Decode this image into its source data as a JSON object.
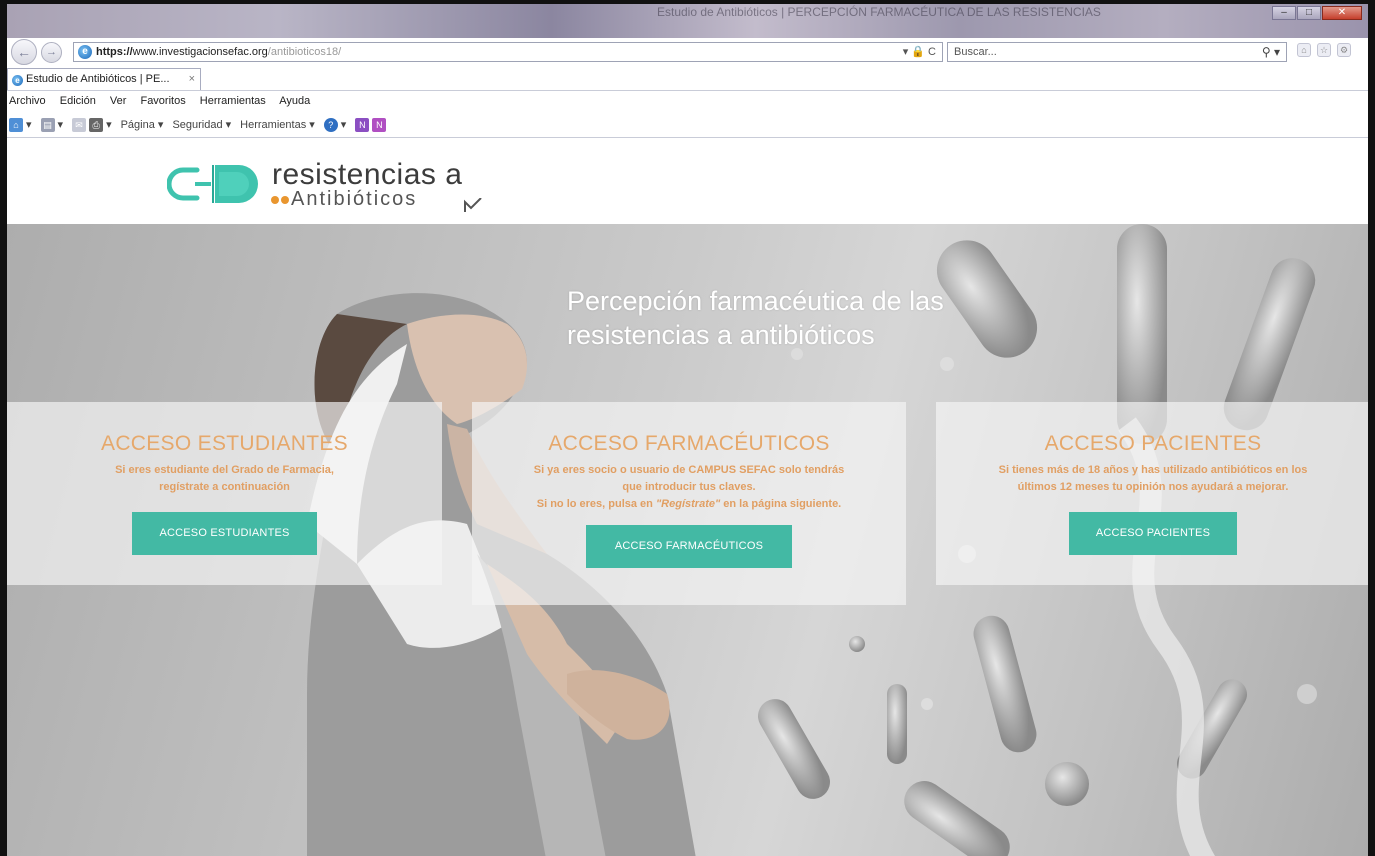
{
  "browser": {
    "window_title": "Estudio de Antibióticos | PERCEPCIÓN FARMACÉUTICA DE LAS RESISTENCIAS",
    "url_prefix": "https://",
    "url_domain": "www.investigacionsefac.org",
    "url_path": "/antibioticos18/",
    "url_controls": "▾ 🔒 C",
    "search_placeholder": "Buscar...",
    "search_icon": "⚲ ▾",
    "tab_title": "Estudio de Antibióticos | PE...",
    "tab_close": "×",
    "menu": [
      "Archivo",
      "Edición",
      "Ver",
      "Favoritos",
      "Herramientas",
      "Ayuda"
    ],
    "commands": {
      "home_arrow": "▾",
      "feeds_arrow": "▾",
      "mail_arrow": "▾",
      "print_arrow": "▾",
      "page": "Página ▾",
      "safety": "Seguridad ▾",
      "tools": "Herramientas ▾",
      "help_arrow": "▾"
    },
    "win_buttons": {
      "minimize": "–",
      "maximize": "□",
      "close": "✕"
    }
  },
  "site": {
    "logo_line1": "resistencias a",
    "logo_line2": "Antibióticos",
    "hero_title_line1": "Percepción farmacéutica de las",
    "hero_title_line2": "resistencias a antibióticos",
    "cards": [
      {
        "title": "ACCESO ESTUDIANTES",
        "desc_lines": [
          "Si eres estudiante del Grado de Farmacia,",
          "regístrate a continuación"
        ],
        "button": "ACCESO ESTUDIANTES"
      },
      {
        "title": "ACCESO FARMACÉUTICOS",
        "desc_lines": [
          "Si ya eres socio o usuario de CAMPUS SEFAC solo tendrás",
          "que introducir tus claves.",
          "Si no lo eres, pulsa en",
          "\"Regístrate\"",
          "en la página siguiente."
        ],
        "button": "ACCESO FARMACÉUTICOS"
      },
      {
        "title": "ACCESO PACIENTES",
        "desc_lines": [
          "Si tienes más de 18 años y has utilizado antibióticos en los",
          "últimos 12 meses tu opinión nos ayudará a mejorar."
        ],
        "button": "ACCESO PACIENTES"
      }
    ]
  },
  "colors": {
    "accent_teal": "#43b9a4",
    "card_text_orange": "#e19f63",
    "logo_dot_orange": "#e9962f",
    "logo_teal": "#3fc3ae"
  }
}
